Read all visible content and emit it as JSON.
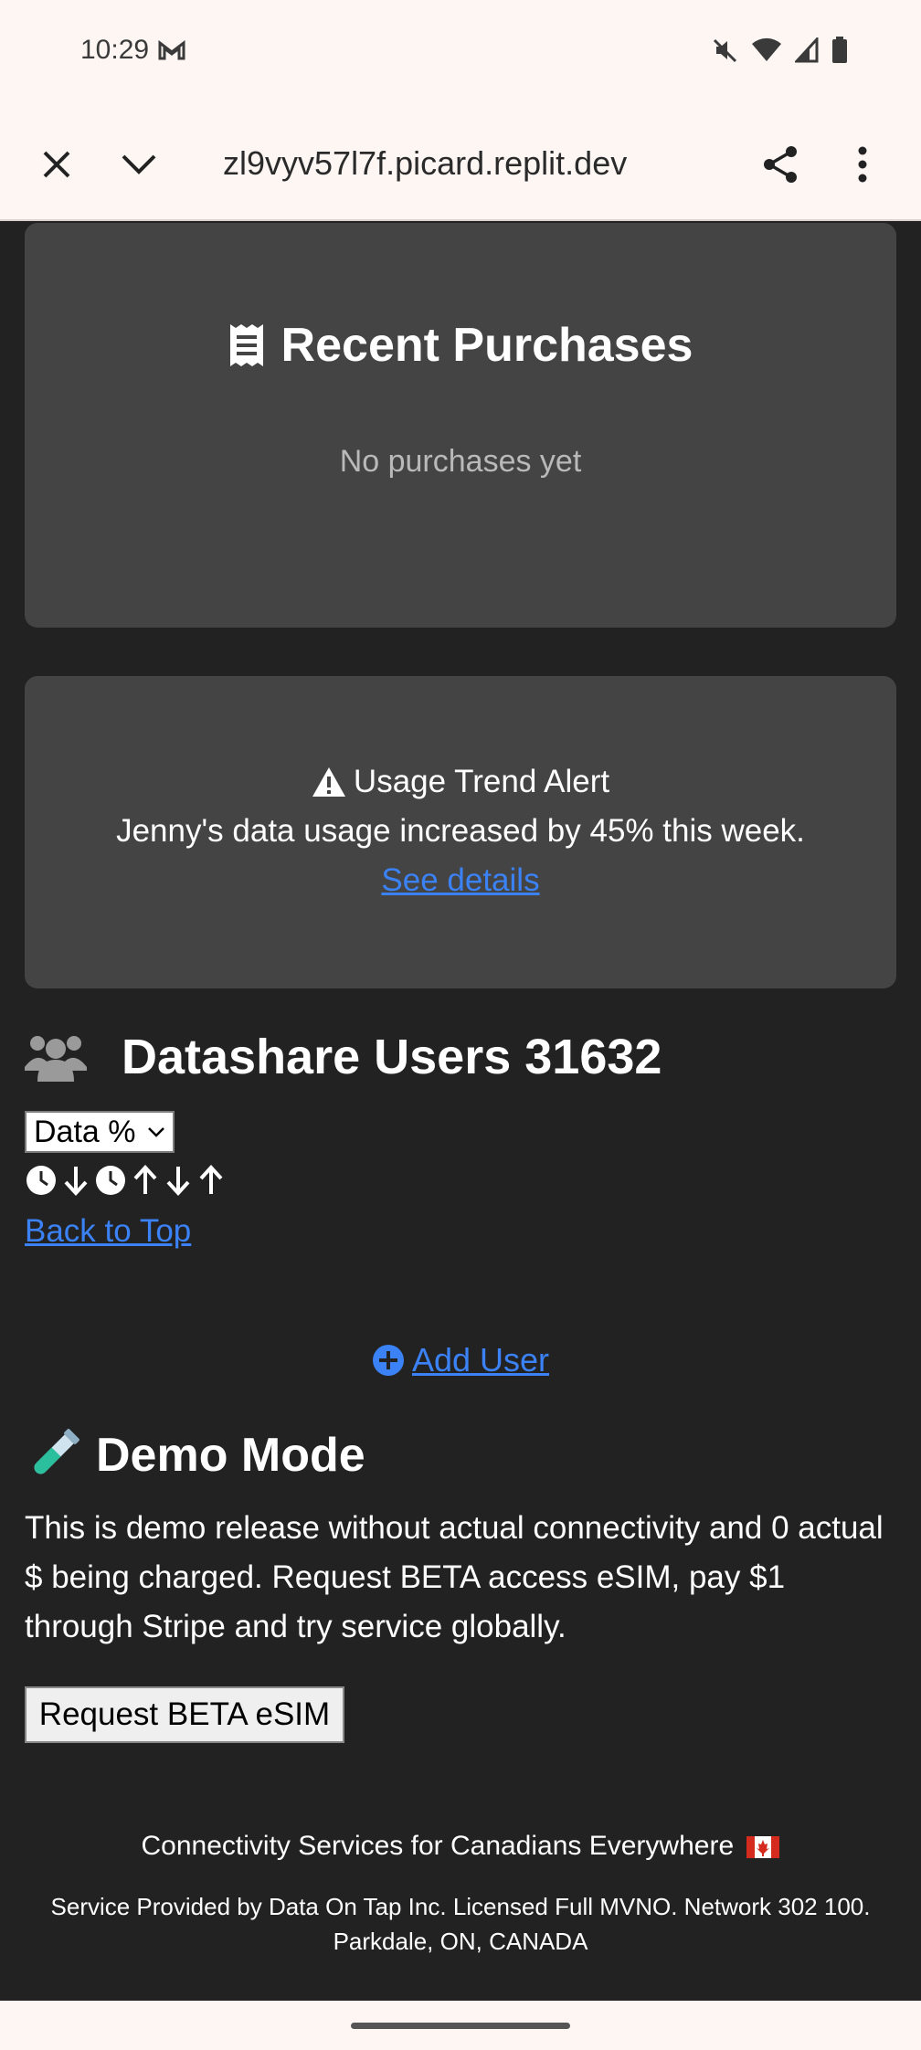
{
  "status_bar": {
    "time": "10:29"
  },
  "browser": {
    "url": "zl9vyv57l7f.picard.replit.dev"
  },
  "purchases": {
    "title": "Recent Purchases",
    "empty_text": "No purchases yet"
  },
  "alert": {
    "title": "Usage Trend Alert",
    "message": "Jenny's data usage increased by 45% this week.",
    "link": "See details"
  },
  "users": {
    "title": "Datashare Users 31632",
    "sort_selected": "Data %",
    "back_to_top": "Back to Top",
    "add_user": "Add User"
  },
  "demo": {
    "title": "Demo Mode",
    "text": "This is demo release without actual connectivity and 0 actual $ being charged. Request BETA access eSIM, pay $1 through Stripe and try service globally.",
    "button": "Request BETA eSIM"
  },
  "footer": {
    "tagline": "Connectivity Services for Canadians Everywhere",
    "provider": "Service Provided by Data On Tap Inc. Licensed Full MVNO. Network 302 100. Parkdale, ON, CANADA"
  },
  "colors": {
    "card": "#444444",
    "background": "#222223",
    "link": "#3b82f6"
  }
}
